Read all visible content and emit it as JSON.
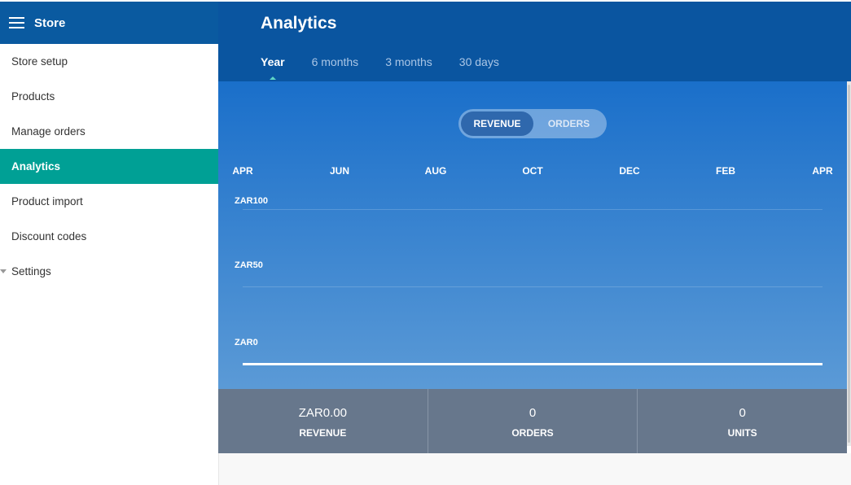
{
  "store": {
    "title": "Store"
  },
  "sidebar": {
    "items": [
      {
        "label": "Store setup",
        "active": false
      },
      {
        "label": "Products",
        "active": false
      },
      {
        "label": "Manage orders",
        "active": false
      },
      {
        "label": "Analytics",
        "active": true
      },
      {
        "label": "Product import",
        "active": false
      },
      {
        "label": "Discount codes",
        "active": false
      },
      {
        "label": "Settings",
        "active": false
      }
    ]
  },
  "header": {
    "title": "Analytics",
    "tabs": [
      {
        "label": "Year",
        "active": true
      },
      {
        "label": "6 months",
        "active": false
      },
      {
        "label": "3 months",
        "active": false
      },
      {
        "label": "30 days",
        "active": false
      }
    ]
  },
  "toggle": {
    "revenue": "REVENUE",
    "orders": "ORDERS",
    "selected": "REVENUE"
  },
  "chart_data": {
    "type": "line",
    "x": [
      "APR",
      "JUN",
      "AUG",
      "OCT",
      "DEC",
      "FEB",
      "APR"
    ],
    "y_ticks": [
      "ZAR100",
      "ZAR50",
      "ZAR0"
    ],
    "series": [
      {
        "values": [
          0,
          0,
          0,
          0,
          0,
          0,
          0
        ]
      }
    ],
    "ylim": [
      0,
      100
    ]
  },
  "stats": [
    {
      "value": "ZAR0.00",
      "label": "REVENUE"
    },
    {
      "value": "0",
      "label": "ORDERS"
    },
    {
      "value": "0",
      "label": "UNITS"
    }
  ],
  "colors": {
    "header": "#0a55a0",
    "accent": "#00a095",
    "stats_bg": "#67778c"
  }
}
